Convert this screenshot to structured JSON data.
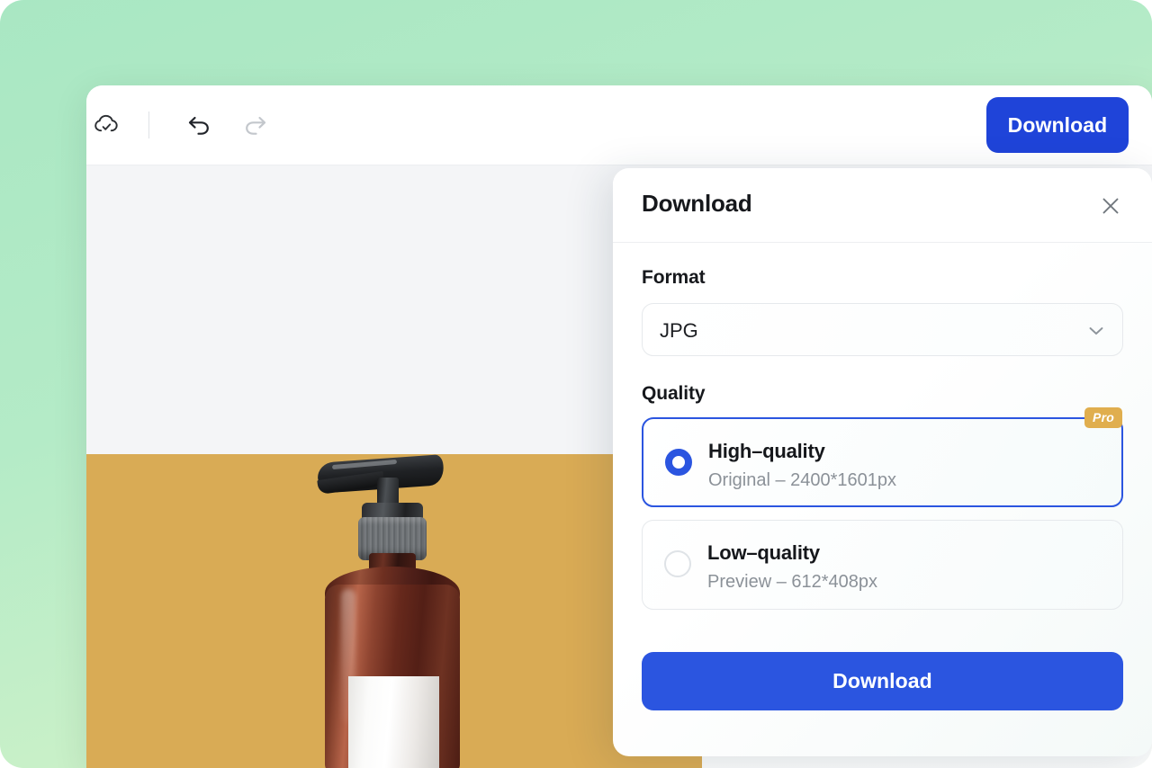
{
  "toolbar": {
    "save_icon": "cloud-check-icon",
    "undo_icon": "undo-arrow-icon",
    "redo_icon": "redo-arrow-icon",
    "download_label": "Download"
  },
  "canvas": {
    "background_color": "#f4f5f7",
    "photo_background_color": "#d9ab55",
    "photo_subject": "amber-pump-bottle"
  },
  "dialog": {
    "title": "Download",
    "close_icon": "close-x-icon",
    "format": {
      "label": "Format",
      "selected": "JPG",
      "chevron_icon": "chevron-down-icon"
    },
    "quality": {
      "label": "Quality",
      "options": [
        {
          "title": "High–quality",
          "subtitle": "Original – 2400*1601px",
          "badge": "Pro",
          "selected": true
        },
        {
          "title": "Low–quality",
          "subtitle": "Preview – 612*408px",
          "badge": "",
          "selected": false
        }
      ]
    },
    "submit_label": "Download"
  },
  "colors": {
    "accent_blue": "#2b55e0",
    "toolbar_blue": "#1f44d9",
    "pro_gold": "#e0ae4e",
    "frame_green": "#a9e7c3",
    "photo_gold": "#d9ab55"
  }
}
